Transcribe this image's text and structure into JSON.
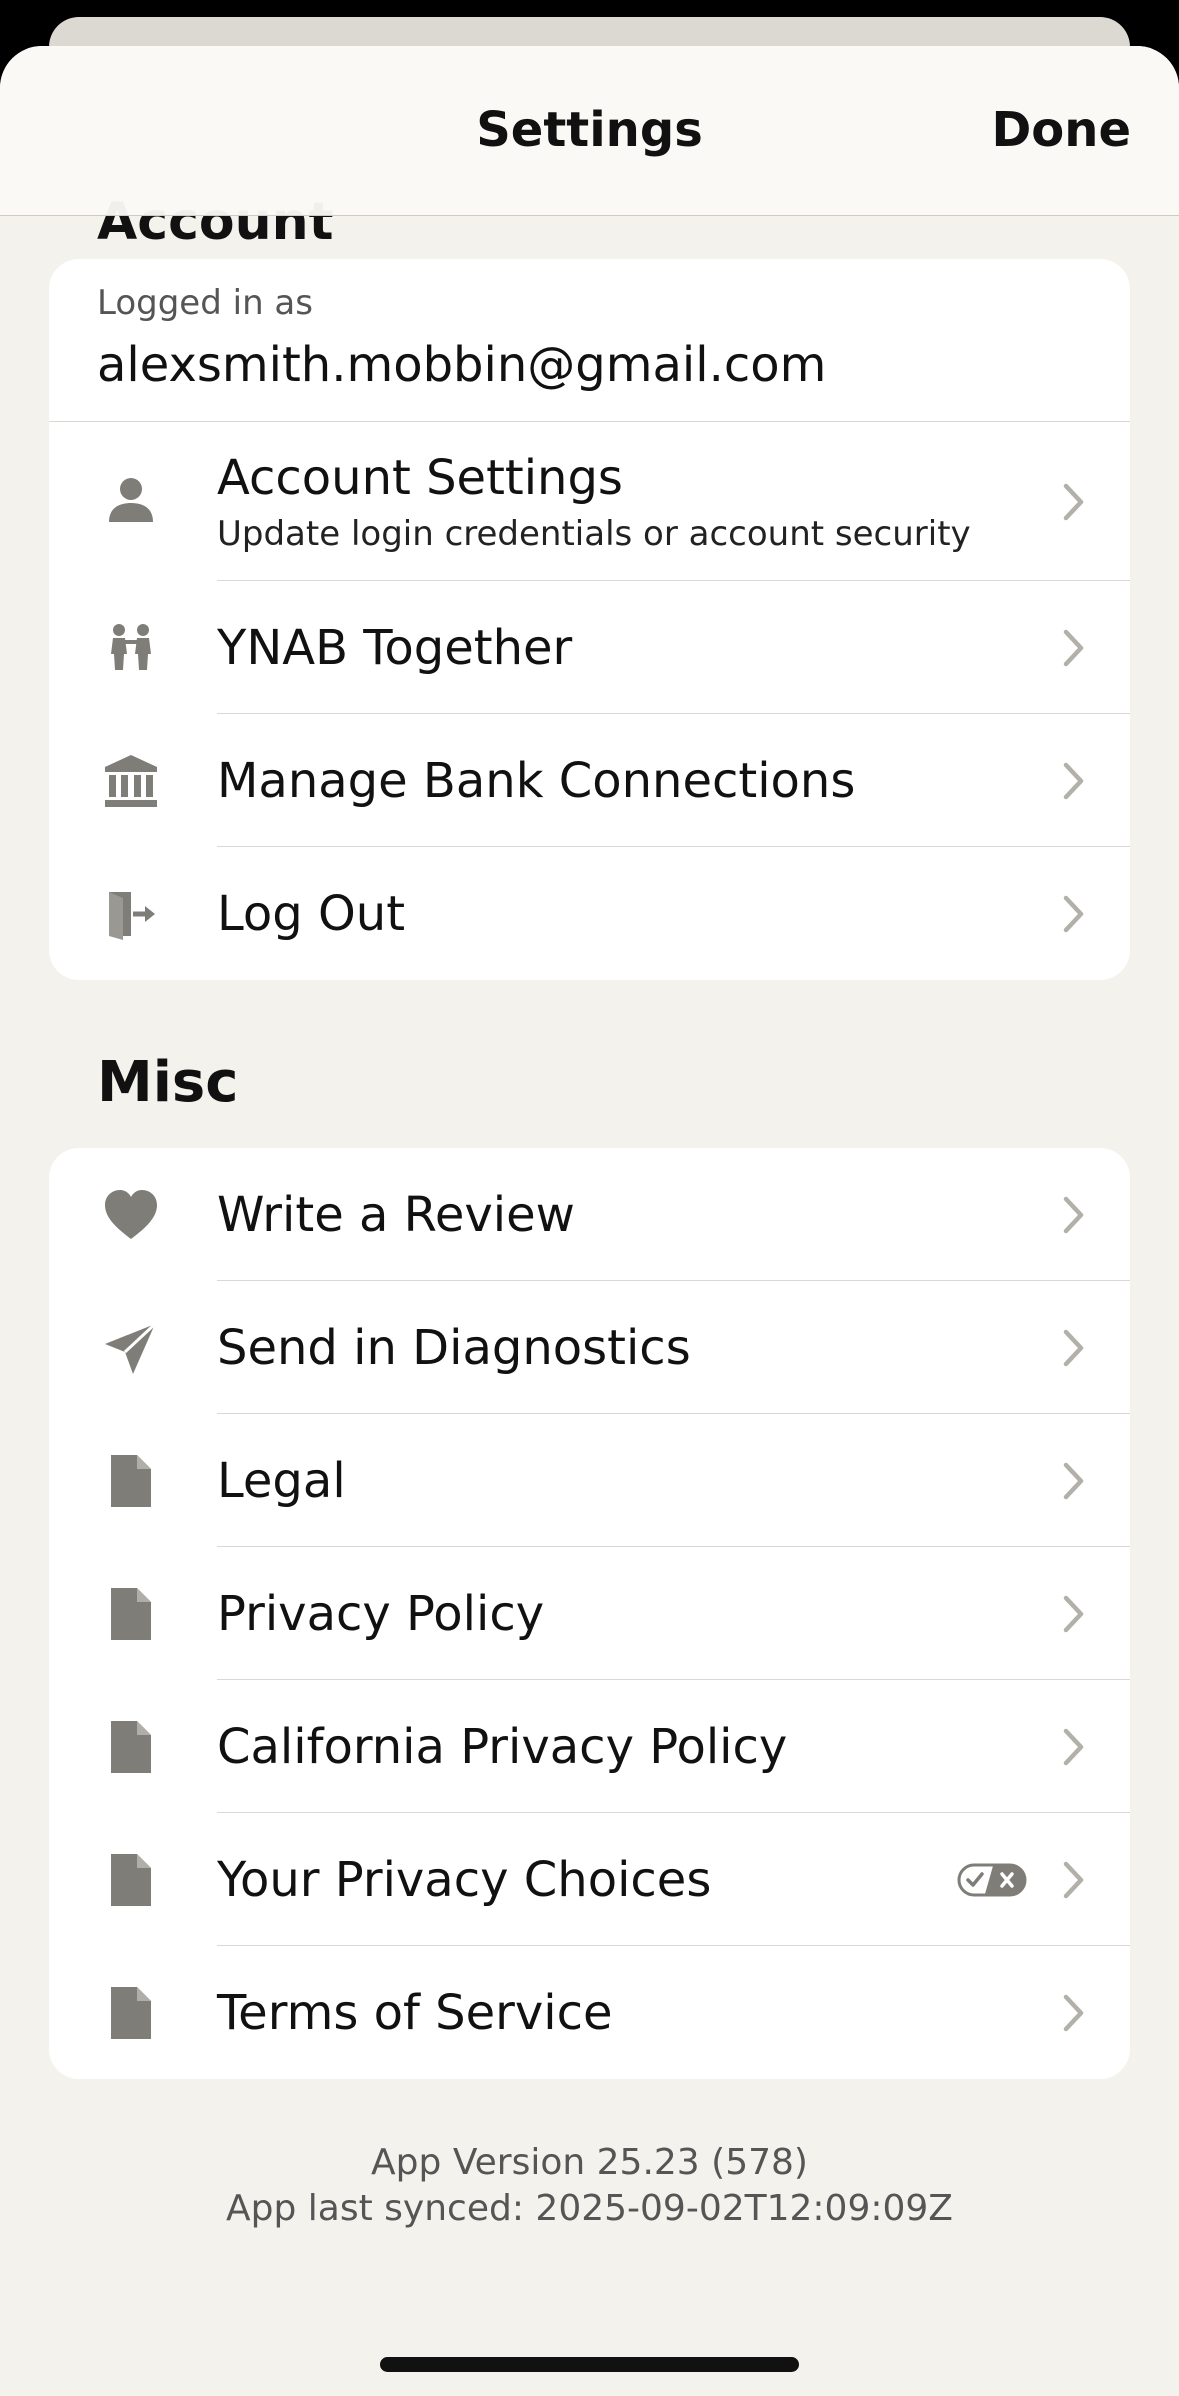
{
  "header": {
    "title": "Settings",
    "done_label": "Done"
  },
  "account": {
    "section_title": "Account",
    "logged_in_label": "Logged in as",
    "email": "alexsmith.mobbin@gmail.com",
    "items": [
      {
        "label": "Account Settings",
        "subtitle": "Update login credentials or account security",
        "icon": "person-icon"
      },
      {
        "label": "YNAB Together",
        "icon": "people-icon"
      },
      {
        "label": "Manage Bank Connections",
        "icon": "bank-icon"
      },
      {
        "label": "Log Out",
        "icon": "logout-icon"
      }
    ]
  },
  "misc": {
    "section_title": "Misc",
    "items": [
      {
        "label": "Write a Review",
        "icon": "heart-icon"
      },
      {
        "label": "Send in Diagnostics",
        "icon": "paper-plane-icon"
      },
      {
        "label": "Legal",
        "icon": "document-icon"
      },
      {
        "label": "Privacy Policy",
        "icon": "document-icon"
      },
      {
        "label": "California Privacy Policy",
        "icon": "document-icon"
      },
      {
        "label": "Your Privacy Choices",
        "icon": "document-icon",
        "badge_icon": "privacy-options-icon"
      },
      {
        "label": "Terms of Service",
        "icon": "document-icon"
      }
    ]
  },
  "footer": {
    "version": "App Version 25.23 (578)",
    "synced": "App last synced: 2025-09-02T12:09:09Z"
  },
  "colors": {
    "background": "#f4f2ec",
    "card": "#ffffff",
    "icon": "#7f7d78",
    "chevron": "#b3b0aa",
    "text": "#111111"
  }
}
